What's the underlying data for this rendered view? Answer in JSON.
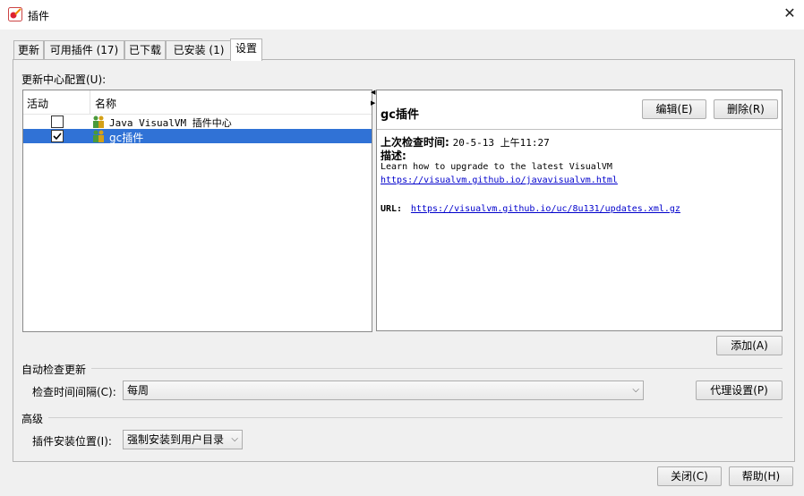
{
  "window": {
    "title": "插件",
    "close_glyph": "✕"
  },
  "tabs": [
    {
      "label": "更新"
    },
    {
      "label": "可用插件 (17)"
    },
    {
      "label": "已下载"
    },
    {
      "label": "已安装 (1)"
    },
    {
      "label": "设置",
      "active": true
    }
  ],
  "update_center": {
    "section_label": "更新中心配置(U):",
    "columns": {
      "active": "活动",
      "name": "名称"
    },
    "rows": [
      {
        "active": false,
        "name": "Java VisualVM 插件中心",
        "selected": false
      },
      {
        "active": true,
        "name": "gc插件",
        "selected": true
      }
    ]
  },
  "detail": {
    "title": "gc插件",
    "edit_button": "编辑(E)",
    "delete_button": "删除(R)",
    "last_check_label": "上次检查时间:",
    "last_check_value": "20-5-13 上午11:27",
    "description_label": "描述:",
    "description_text": "Learn how to upgrade to the latest VisualVM",
    "description_link": "https://visualvm.github.io/javavisualvm.html",
    "url_label": "URL:",
    "url_value": "https://visualvm.github.io/uc/8u131/updates.xml.gz"
  },
  "add_button": "添加(A)",
  "auto_check": {
    "section_label": "自动检查更新",
    "interval_label": "检查时间间隔(C):",
    "interval_value": "每周",
    "proxy_button": "代理设置(P)"
  },
  "advanced": {
    "section_label": "高级",
    "install_location_label": "插件安装位置(I):",
    "install_location_value": "强制安装到用户目录"
  },
  "footer": {
    "close_button": "关闭(C)",
    "help_button": "帮助(H)"
  },
  "colors": {
    "selection": "#3072d6",
    "link": "#0000cc"
  }
}
